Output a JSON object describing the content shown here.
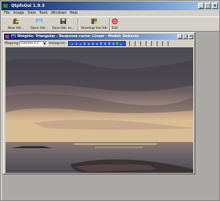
{
  "window": {
    "title": "QtpfsGui 1.9.3"
  },
  "menu": [
    "File",
    "Image",
    "View",
    "Tools",
    "Windows",
    "Help"
  ],
  "toolbar": {
    "new_hdr": "New Hdr...",
    "open_hdr": "Open Hdr...",
    "save_hdr": "Save Hdr. as...",
    "tonemap": "Tonemap the Hdr",
    "exit": "Exit"
  },
  "child": {
    "title": "(*) Weights: Triangular - Response curve: Linear - Model: Debevec",
    "mapping_label": "Mapping:",
    "mapping_value": "Gamma 2.2",
    "histogram_label": "Histogram:"
  }
}
